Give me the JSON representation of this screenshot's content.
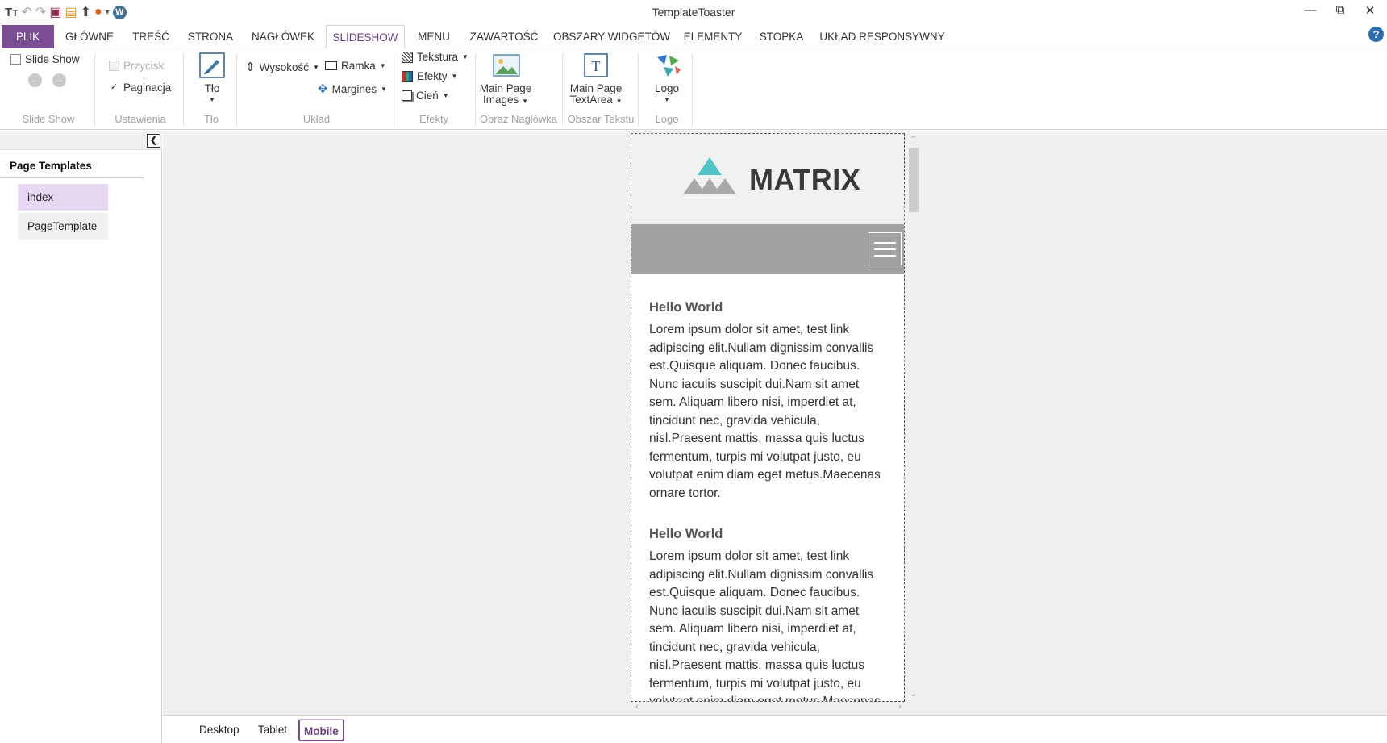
{
  "app": {
    "title": "TemplateToaster",
    "window_controls": {
      "minimize": "—",
      "restore": "⧉",
      "close": "✕"
    }
  },
  "quick_access": [
    {
      "icon": "tt-logo-icon",
      "glyph": "Tᴛ"
    },
    {
      "icon": "undo-icon",
      "glyph": "↶"
    },
    {
      "icon": "redo-icon",
      "glyph": "↷"
    },
    {
      "icon": "save-icon",
      "glyph": "▣"
    },
    {
      "icon": "open-folder-icon",
      "glyph": "▤"
    },
    {
      "icon": "export-icon",
      "glyph": "⬆"
    },
    {
      "icon": "browser-preview-icon",
      "glyph": "●"
    },
    {
      "icon": "dropdown-icon",
      "glyph": "▾"
    },
    {
      "icon": "wordpress-icon",
      "glyph": "W"
    }
  ],
  "ribbon_tabs": [
    {
      "label": "PLIK",
      "state": "file"
    },
    {
      "label": "GŁÓWNE"
    },
    {
      "label": "TREŚĆ"
    },
    {
      "label": "STRONA"
    },
    {
      "label": "NAGŁÓWEK"
    },
    {
      "label": "SLIDESHOW",
      "state": "active"
    },
    {
      "label": "MENU"
    },
    {
      "label": "ZAWARTOŚĆ"
    },
    {
      "label": "OBSZARY WIDGETÓW"
    },
    {
      "label": "ELEMENTY"
    },
    {
      "label": "STOPKA"
    },
    {
      "label": "UKŁAD RESPONSYWNY"
    }
  ],
  "help": "?",
  "ribbon": {
    "slideshow": {
      "checkbox": "Slide Show",
      "checked": false,
      "group": "Slide Show"
    },
    "ustawienia": {
      "przycisk": "Przycisk",
      "przycisk_checked": false,
      "paginacja": "Paginacja",
      "paginacja_checked": true,
      "group": "Ustawienia"
    },
    "tlo": {
      "button": "Tło",
      "group": "Tło"
    },
    "uklad": {
      "wysokosc": "Wysokość",
      "ramka": "Ramka",
      "margines": "Margines",
      "group": "Układ"
    },
    "efekty": {
      "tekstura": "Tekstura",
      "efekty": "Efekty",
      "cien": "Cień",
      "group": "Efekty"
    },
    "obraz": {
      "line1": "Main Page",
      "line2": "Images",
      "group": "Obraz Nagłówka"
    },
    "obszar": {
      "line1": "Main Page",
      "line2": "TextArea",
      "group": "Obszar Tekstu"
    },
    "logo": {
      "button": "Logo",
      "group": "Logo"
    }
  },
  "left_panel": {
    "title": "Page Templates",
    "templates": [
      {
        "label": "index",
        "selected": true
      },
      {
        "label": "PageTemplate",
        "selected": false
      }
    ]
  },
  "preview": {
    "logo_text": "MATRIX",
    "articles": [
      {
        "heading": "Hello World",
        "lines": [
          " Lorem ipsum dolor sit amet, test link",
          "adipiscing elit.Nullam dignissim convallis",
          "est.Quisque aliquam. Donec faucibus.",
          "Nunc iaculis suscipit dui.Nam sit amet",
          "sem. Aliquam libero nisi, imperdiet at,",
          "tincidunt nec, gravida vehicula,",
          "nisl.Praesent mattis, massa quis luctus",
          "fermentum, turpis mi volutpat justo, eu",
          "volutpat enim diam eget metus.Maecenas",
          "ornare tortor."
        ]
      },
      {
        "heading": "Hello World",
        "lines": [
          " Lorem ipsum dolor sit amet, test link",
          "adipiscing elit.Nullam dignissim convallis",
          "est.Quisque aliquam. Donec faucibus.",
          "Nunc iaculis suscipit dui.Nam sit amet",
          "sem. Aliquam libero nisi, imperdiet at,",
          "tincidunt nec, gravida vehicula,",
          "nisl.Praesent mattis, massa quis luctus",
          "fermentum, turpis mi volutpat justo, eu",
          "volutpat enim diam eget metus.Maecenas"
        ]
      }
    ]
  },
  "device_tabs": [
    {
      "label": "Desktop"
    },
    {
      "label": "Tablet"
    },
    {
      "label": "Mobile",
      "active": true
    }
  ],
  "colors": {
    "accent": "#7b4e93",
    "selected_template": "#e6d8f0",
    "logo_teal": "#4ec5c8",
    "logo_gray": "#a9a9a9",
    "nav_gray": "#a2a2a2"
  }
}
